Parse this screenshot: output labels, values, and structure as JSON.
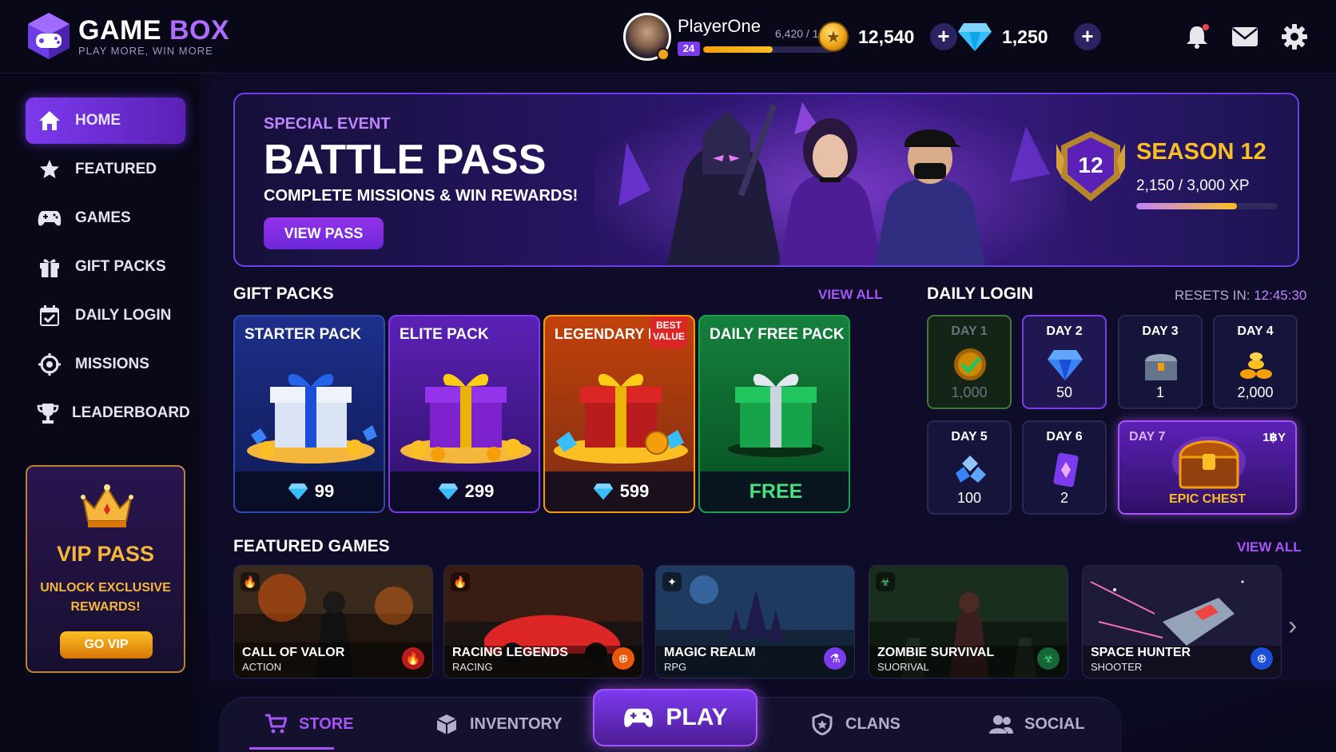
{
  "brand": {
    "title_a": "GAME ",
    "title_b": "BOX",
    "subtitle": "PLAY MORE, WIN MORE"
  },
  "player": {
    "name": "PlayerOne",
    "level": "24",
    "xp_text": "6,420 / 12,000",
    "xp_progress": 0.535
  },
  "currency": {
    "coins": "12,540",
    "gems": "1,250",
    "coin_icon": "coin-icon",
    "gem_icon": "diamond-icon"
  },
  "header_icons": [
    "bell-icon",
    "mail-icon",
    "gear-icon"
  ],
  "sidebar": {
    "items": [
      {
        "label": "HOME",
        "icon": "home-icon",
        "active": true
      },
      {
        "label": "FEATURED",
        "icon": "star-icon"
      },
      {
        "label": "GAMES",
        "icon": "gamepad-icon"
      },
      {
        "label": "GIFT PACKS",
        "icon": "gift-icon"
      },
      {
        "label": "DAILY LOGIN",
        "icon": "calendar-icon"
      },
      {
        "label": "MISSIONS",
        "icon": "target-icon"
      },
      {
        "label": "LEADERBOARD",
        "icon": "trophy-icon"
      }
    ],
    "vip": {
      "title": "VIP PASS",
      "subtitle": "UNLOCK EXCLUSIVE REWARDS!",
      "button": "GO VIP"
    }
  },
  "banner": {
    "event": "SPECIAL EVENT",
    "title": "BATTLE PASS",
    "subtitle": "COMPLETE MISSIONS & WIN REWARDS!",
    "button": "VIEW PASS",
    "season_number": "12",
    "season_title": "SEASON 12",
    "season_xp": "2,150 / 3,000 XP",
    "season_progress": 0.717
  },
  "gift_packs": {
    "title": "GIFT PACKS",
    "view_all": "VIEW ALL",
    "packs": [
      {
        "name": "STARTER PACK",
        "price": "99"
      },
      {
        "name": "ELITE PACK",
        "price": "299"
      },
      {
        "name": "LEGENDARY PACK",
        "price": "599",
        "badge": "BEST VALUE"
      },
      {
        "name": "DAILY FREE PACK",
        "price": "FREE"
      }
    ]
  },
  "daily_login": {
    "title": "DAILY LOGIN",
    "reset_label": "RESETS IN: ",
    "reset_time": "12:45:30",
    "days": [
      {
        "label": "DAY 1",
        "value": "1,000",
        "state": "claimed"
      },
      {
        "label": "DAY 2",
        "value": "50",
        "state": "today"
      },
      {
        "label": "DAY 3",
        "value": "1"
      },
      {
        "label": "DAY 4",
        "value": "2,000"
      },
      {
        "label": "DAY 5",
        "value": "100"
      },
      {
        "label": "DAY 6",
        "value": "2"
      }
    ],
    "day7": {
      "label": "DAY 7",
      "corner": "1฿Y",
      "reward": "EPIC CHEST"
    }
  },
  "featured_games": {
    "title": "FEATURED GAMES",
    "view_all": "VIEW ALL",
    "games": [
      {
        "title": "CALL OF VALOR",
        "genre": "ACTION"
      },
      {
        "title": "RACING LEGENDS",
        "genre": "RACING"
      },
      {
        "title": "MAGIC REALM",
        "genre": "RPG"
      },
      {
        "title": "ZOMBIE SURVIVAL",
        "genre": "SUORIVAL"
      },
      {
        "title": "SPACE HUNTER",
        "genre": "SHOOTER"
      }
    ]
  },
  "bottom_nav": {
    "store": "STORE",
    "inventory": "INVENTORY",
    "play": "PLAY",
    "clans": "CLANS",
    "social": "SOCIAL"
  },
  "colors": {
    "accent": "#a855f7",
    "gold": "#fbbf24",
    "bg": "#0a0a1f"
  }
}
